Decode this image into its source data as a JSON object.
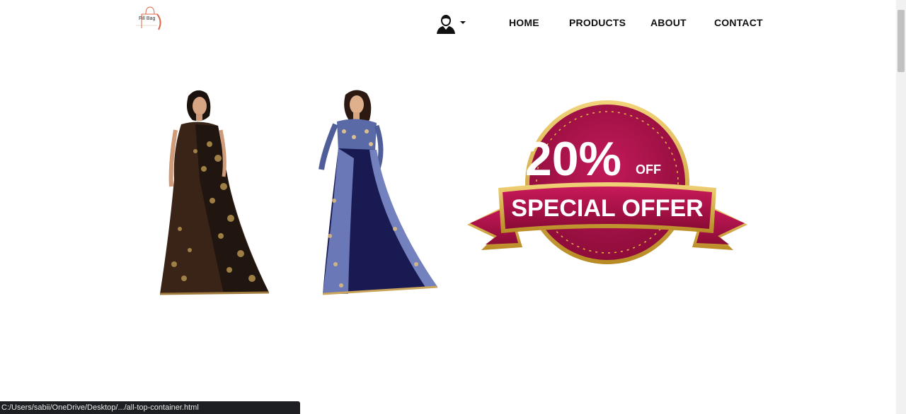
{
  "header": {
    "logo_text": "Fill Bag",
    "user_menu_icon": "user-avatar-icon",
    "user_menu_caret": "caret-down-icon"
  },
  "nav": {
    "items": [
      {
        "label": "HOME"
      },
      {
        "label": "PRODUCTS"
      },
      {
        "label": "ABOUT"
      },
      {
        "label": "CONTACT"
      }
    ]
  },
  "products": [
    {
      "image": "brown-saree-image"
    },
    {
      "image": "navy-blue-saree-image"
    }
  ],
  "offer": {
    "percent": "20%",
    "off": "OFF",
    "label": "SPECIAL OFFER",
    "colors": {
      "crimson": "#b0124a",
      "gold": "#d4a72c"
    }
  },
  "status_bar": {
    "url": "C:/Users/sabii/OneDrive/Desktop/.../all-top-container.html"
  }
}
